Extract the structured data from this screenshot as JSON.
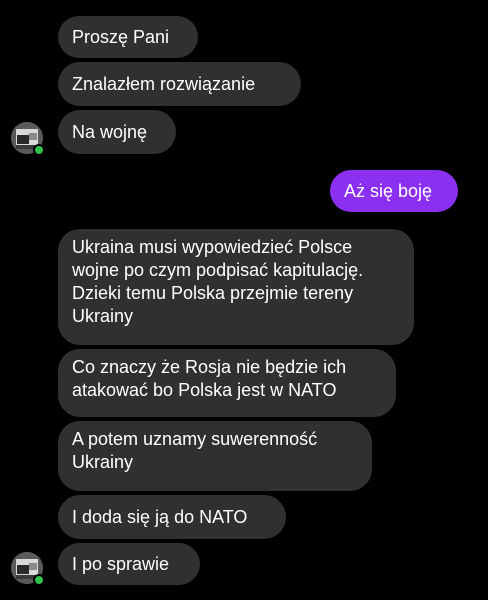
{
  "conversation": {
    "messages": [
      {
        "sender": "other",
        "text": "Proszę Pani"
      },
      {
        "sender": "other",
        "text": "Znalazłem rozwiązanie"
      },
      {
        "sender": "other",
        "text": "Na wojnę"
      },
      {
        "sender": "me",
        "text": "Aż się boję"
      },
      {
        "sender": "other",
        "text": "Ukraina musi wypowiedzieć Polsce wojne po czym podpisać kapitulację. Dzieki temu Polska przejmie tereny Ukrainy"
      },
      {
        "sender": "other",
        "text": "Co znaczy że Rosja nie będzie ich atakować bo Polska jest w NATO"
      },
      {
        "sender": "other",
        "text": "A potem uznamy suwerenność Ukrainy"
      },
      {
        "sender": "other",
        "text": "I doda się ją do NATO"
      },
      {
        "sender": "other",
        "text": "I po sprawie"
      }
    ]
  },
  "colors": {
    "background": "#000000",
    "received_bubble": "#303030",
    "sent_bubble": "#8b2ff0",
    "text": "#ffffff",
    "online_indicator": "#31c24d"
  },
  "icons": {
    "avatar": "contact-avatar-photo",
    "presence": "online-status-dot"
  }
}
